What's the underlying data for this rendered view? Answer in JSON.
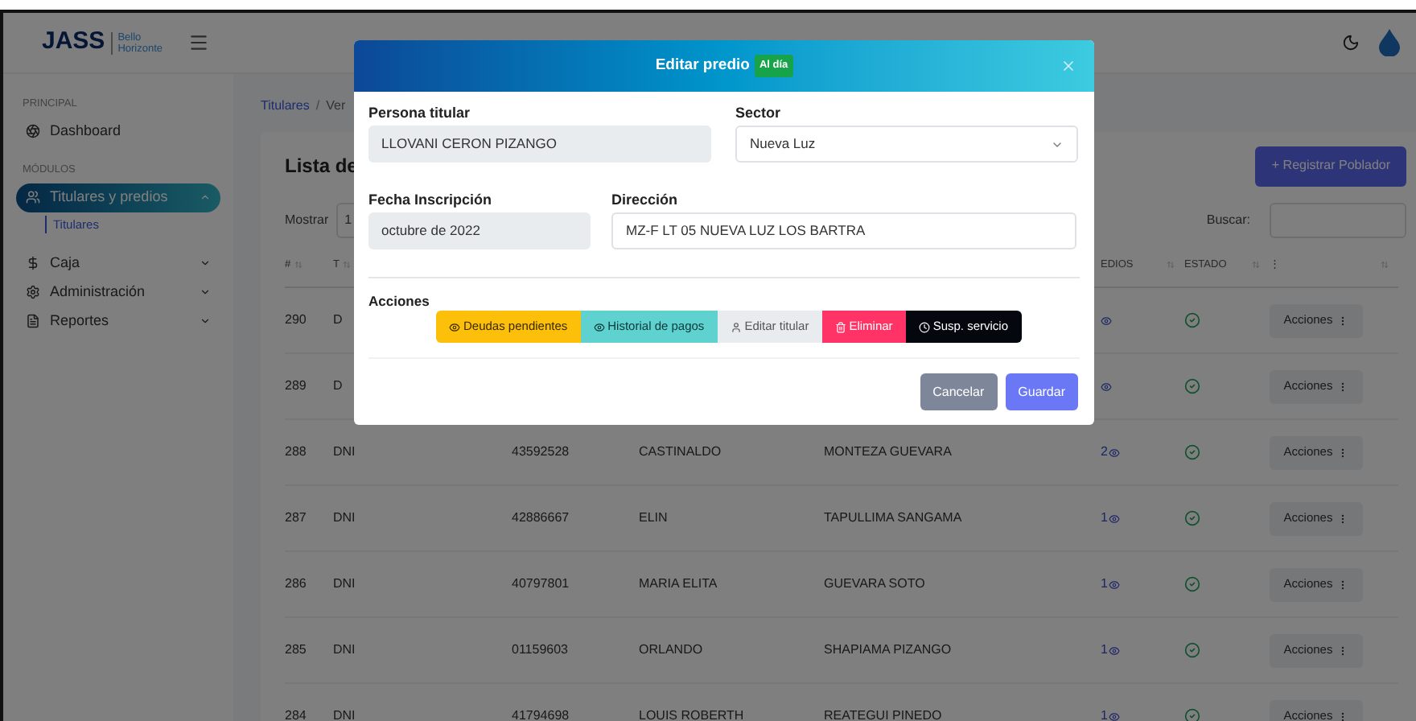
{
  "header": {
    "logo": "JASS",
    "logo_sub": "Bello Horizonte"
  },
  "sidebar": {
    "sections": [
      {
        "title": "PRINCIPAL",
        "items": [
          {
            "label": "Dashboard",
            "selected": false
          }
        ]
      },
      {
        "title": "MÓDULOS",
        "items": [
          {
            "label": "Titulares y predios",
            "selected": true,
            "expanded": true,
            "children": [
              {
                "label": "Titulares",
                "selected": true
              }
            ]
          },
          {
            "label": "Caja",
            "selected": false,
            "expanded": false
          },
          {
            "label": "Administración",
            "selected": false,
            "expanded": false
          },
          {
            "label": "Reportes",
            "selected": false,
            "expanded": false
          }
        ]
      }
    ]
  },
  "breadcrumb": {
    "items": [
      "Titulares",
      "Ver"
    ],
    "separator": "/"
  },
  "card": {
    "title": "Lista de",
    "primary_button": "+ Registrar Poblador",
    "show_label": "Mostrar",
    "show_value": "1",
    "search_label": "Buscar:"
  },
  "table": {
    "columns": [
      "#",
      "T",
      "EDIOS",
      "ESTADO",
      "⋮"
    ],
    "rows": [
      {
        "num": "290",
        "doc": "D",
        "active": true,
        "action": "Acciones"
      },
      {
        "num": "289",
        "doc": "D",
        "active": true,
        "action": "Acciones"
      },
      {
        "num": "288",
        "doc": "DNI",
        "dni": "43592528",
        "nombres": "CASTINALDO",
        "apellidos": "MONTEZA GUEVARA",
        "predios": "2",
        "active": true,
        "action": "Acciones"
      },
      {
        "num": "287",
        "doc": "DNI",
        "dni": "42886667",
        "nombres": "ELIN",
        "apellidos": "TAPULLIMA SANGAMA",
        "predios": "1",
        "active": true,
        "action": "Acciones"
      },
      {
        "num": "286",
        "doc": "DNI",
        "dni": "40797801",
        "nombres": "MARIA ELITA",
        "apellidos": "GUEVARA SOTO",
        "predios": "1",
        "active": true,
        "action": "Acciones"
      },
      {
        "num": "285",
        "doc": "DNI",
        "dni": "01159603",
        "nombres": "ORLANDO",
        "apellidos": "SHAPIAMA PIZANGO",
        "predios": "1",
        "active": true,
        "action": "Acciones"
      },
      {
        "num": "284",
        "doc": "DNI",
        "dni": "41794698",
        "nombres": "LOUIS ROBERTH",
        "apellidos": "REATEGUI PINEDO",
        "predios": "1",
        "active": true,
        "action": "Acciones"
      }
    ]
  },
  "modal": {
    "title": "Editar predio",
    "badge": "Al día",
    "persona": {
      "label": "Persona titular",
      "value": "LLOVANI CERON PIZANGO",
      "readonly": true
    },
    "sector": {
      "label": "Sector",
      "value": "Nueva Luz"
    },
    "fecha": {
      "label": "Fecha Inscripción",
      "value": "octubre de 2022",
      "readonly": true
    },
    "direccion": {
      "label": "Dirección",
      "value": "MZ-F LT 05 NUEVA LUZ LOS BARTRA",
      "readonly": false
    },
    "actions_label": "Acciones",
    "actions": [
      {
        "label": "Deudas pendientes",
        "kind": "warning"
      },
      {
        "label": "Historial de pagos",
        "kind": "info"
      },
      {
        "label": "Editar titular",
        "kind": "light"
      },
      {
        "label": "Eliminar",
        "kind": "danger"
      },
      {
        "label": "Susp. servicio",
        "kind": "dark"
      }
    ],
    "cancel": "Cancelar",
    "save": "Guardar"
  }
}
